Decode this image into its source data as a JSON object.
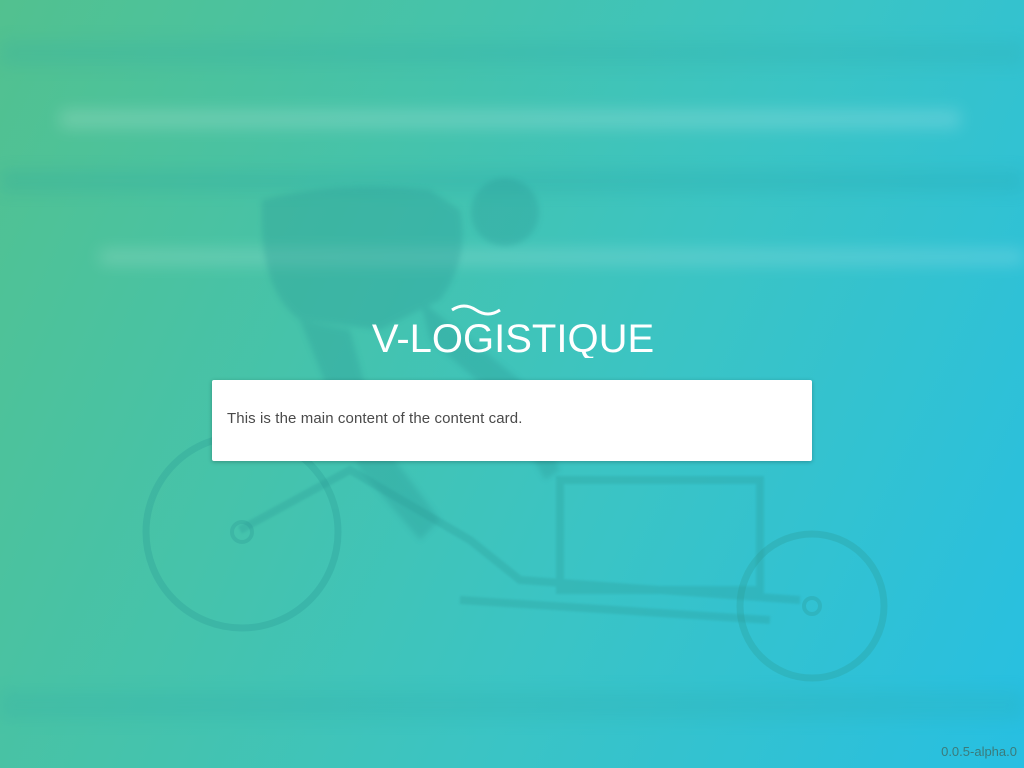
{
  "brand": {
    "logo_text": "V-LOGISTIQUE"
  },
  "card": {
    "content": "This is the main content of the content card."
  },
  "footer": {
    "version": "0.0.5-alpha.0"
  },
  "colors": {
    "gradient_start": "#52c18f",
    "gradient_end": "#27bfe2",
    "card_background": "#ffffff",
    "logo": "#ffffff"
  },
  "background": {
    "description_icon": "cargo-bike-rider-image"
  }
}
